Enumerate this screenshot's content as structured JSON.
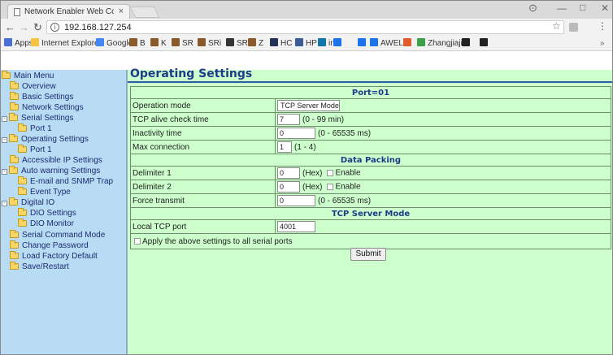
{
  "browser": {
    "tab_title": "Network Enabler Web Co",
    "tab_close": "×",
    "url": "192.168.127.254",
    "info_glyph": "i",
    "bookmarks": [
      {
        "label": "Apps",
        "color": "#4a6fd6"
      },
      {
        "label": "Internet Explorer",
        "color": "#f5c242"
      },
      {
        "label": "Google",
        "color": "#4285f4"
      },
      {
        "label": "B",
        "color": "#8a5a2b"
      },
      {
        "label": "K",
        "color": "#8a5a2b"
      },
      {
        "label": "SR",
        "color": "#8a5a2b"
      },
      {
        "label": "SRi",
        "color": "#8a5a2b"
      },
      {
        "label": "SR",
        "color": "#333333"
      },
      {
        "label": "Z",
        "color": "#8a5a2b"
      },
      {
        "label": "HC",
        "color": "#223355"
      },
      {
        "label": "HP",
        "color": "#3a5a9a"
      },
      {
        "label": "in",
        "color": "#0e76a8"
      },
      {
        "label": "",
        "color": "#1a73e8"
      },
      {
        "label": "",
        "color": "#1a73e8"
      },
      {
        "label": "AWEL",
        "color": "#1a73e8"
      },
      {
        "label": "",
        "color": "#e05a2b"
      },
      {
        "label": "Zhangjiajie",
        "color": "#3aa04a"
      },
      {
        "label": "",
        "color": "#222222"
      },
      {
        "label": "",
        "color": "#222222"
      }
    ]
  },
  "sidebar": {
    "title": "Main Menu",
    "items": [
      {
        "label": "Overview"
      },
      {
        "label": "Basic Settings"
      },
      {
        "label": "Network Settings"
      },
      {
        "label": "Serial Settings"
      },
      {
        "label": "Port 1"
      },
      {
        "label": "Operating Settings"
      },
      {
        "label": "Port 1"
      },
      {
        "label": "Accessible IP Settings"
      },
      {
        "label": "Auto warning Settings"
      },
      {
        "label": "E-mail and SNMP Trap"
      },
      {
        "label": "Event Type"
      },
      {
        "label": "Digital IO"
      },
      {
        "label": "DIO Settings"
      },
      {
        "label": "DIO Monitor"
      },
      {
        "label": "Serial Command Mode"
      },
      {
        "label": "Change Password"
      },
      {
        "label": "Load Factory Default"
      },
      {
        "label": "Save/Restart"
      }
    ]
  },
  "main": {
    "title": "Operating Settings",
    "port_header": "Port=01",
    "rows": {
      "operation_mode": {
        "label": "Operation mode",
        "value": "TCP Server Mode ▾"
      },
      "tcp_alive": {
        "label": "TCP alive check time",
        "value": "7",
        "range": "(0 - 99 min)"
      },
      "inactivity": {
        "label": "Inactivity time",
        "value": "0",
        "range": "(0 - 65535 ms)"
      },
      "max_conn": {
        "label": "Max connection",
        "value": "1",
        "range": "(1 - 4)"
      }
    },
    "data_packing_header": "Data Packing",
    "packing": {
      "delim1": {
        "label": "Delimiter 1",
        "value": "0",
        "unit": "(Hex)",
        "enable_label": "Enable"
      },
      "delim2": {
        "label": "Delimiter 2",
        "value": "0",
        "unit": "(Hex)",
        "enable_label": "Enable"
      },
      "force": {
        "label": "Force transmit",
        "value": "0",
        "range": "(0 - 65535 ms)"
      }
    },
    "tcp_server_header": "TCP Server Mode",
    "local_port": {
      "label": "Local TCP port",
      "value": "4001"
    },
    "apply_all_label": "Apply the above settings to all serial ports",
    "submit_label": "Submit"
  }
}
